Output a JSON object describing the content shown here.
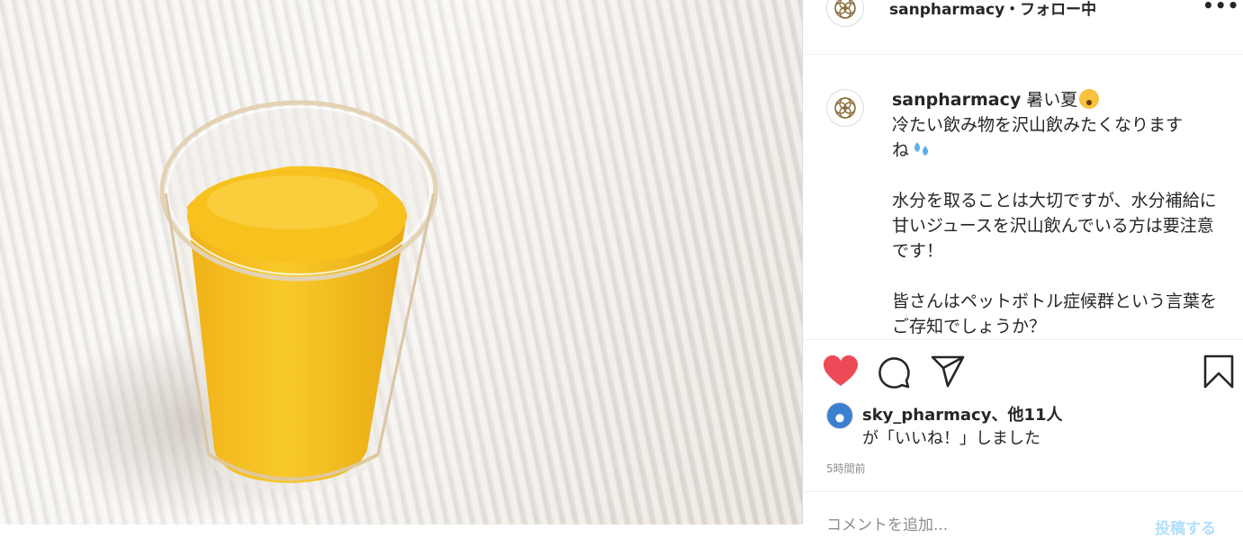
{
  "header": {
    "username": "sanpharmacy",
    "separator": "・",
    "follow_status": "フォロー中",
    "more_label": "•••"
  },
  "caption": {
    "username": "sanpharmacy",
    "line1_after_user": " 暑い夏",
    "line2": "冷たい飲み物を沢山飲みたくなります",
    "line3": "ね",
    "para2": "水分を取ることは大切ですが、水分補給に甘いジュースを沢山飲んでいる方は要注意です！",
    "para3": "皆さんはペットボトル症候群という言葉をご存知でしょうか？"
  },
  "likes": {
    "liker": "sky_pharmacy",
    "others": "、他11人",
    "suffix": "が「いいね！」しました"
  },
  "timestamp": "5時間前",
  "comment": {
    "placeholder": "コメントを追加...",
    "post_label": "投稿する"
  },
  "colors": {
    "heart": "#ed4956",
    "post_button": "#b2dffc",
    "logo": "#8a6d3b"
  }
}
